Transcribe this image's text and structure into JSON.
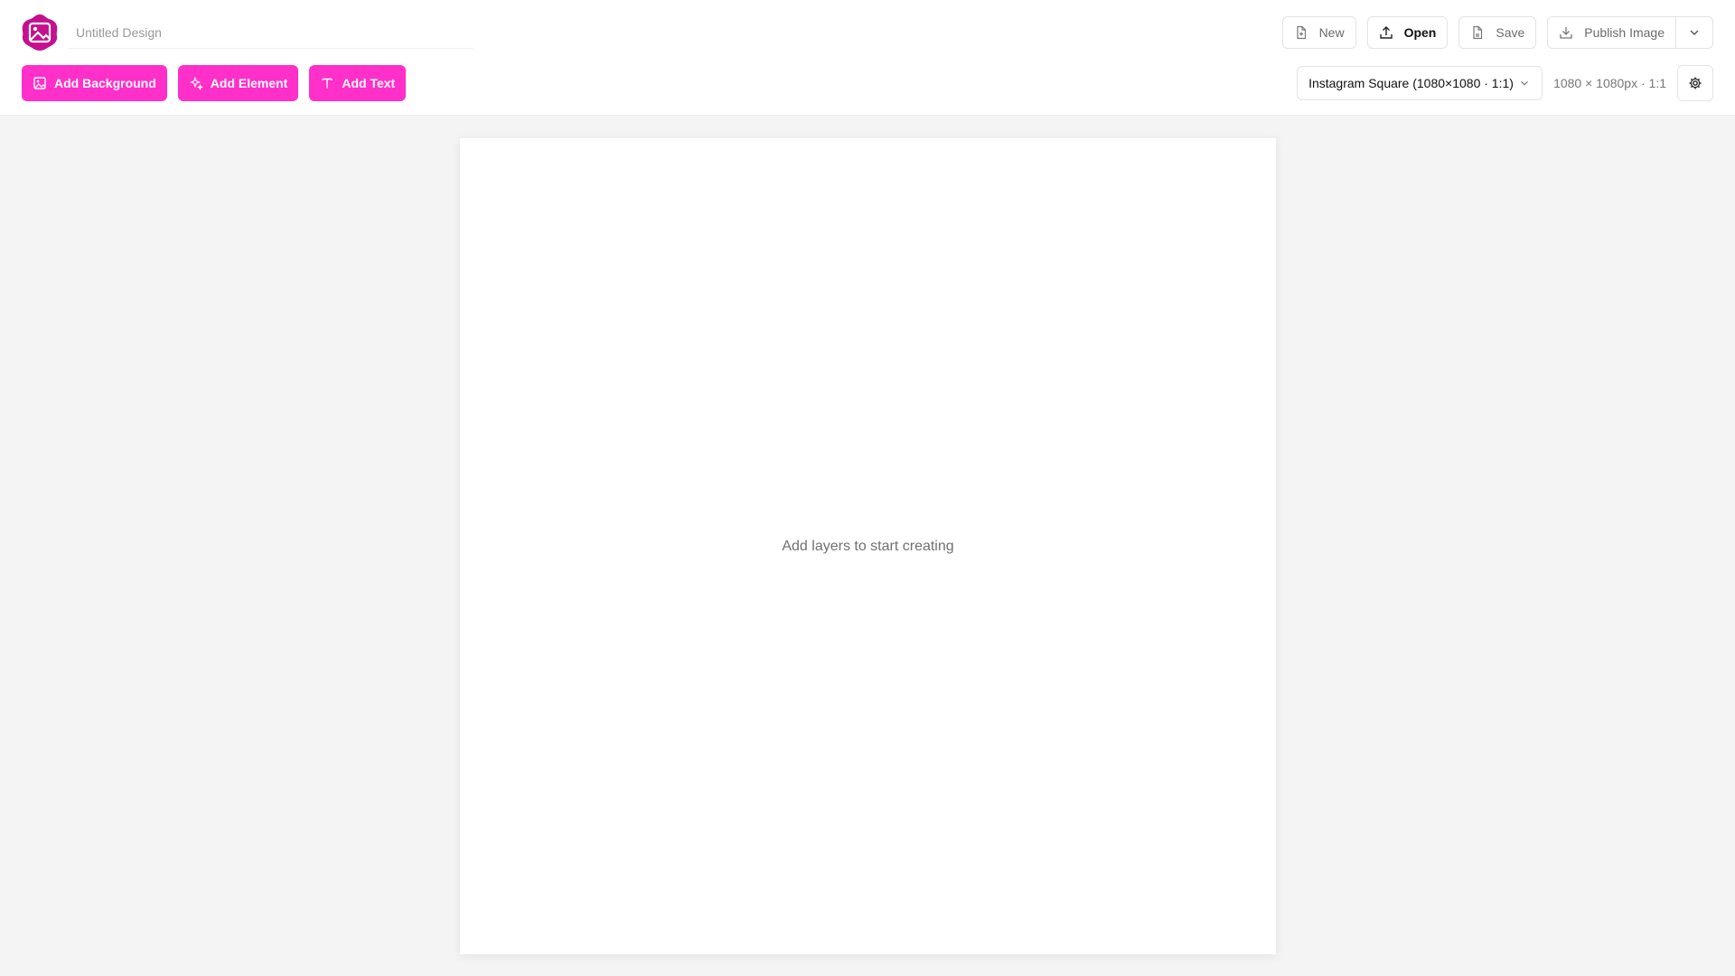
{
  "app": {
    "brand_color": "#ff2fc9",
    "logo_color": "#c4108f",
    "logo_icon": "image-gallery-icon"
  },
  "header": {
    "title_placeholder": "Untitled Design",
    "title_value": ""
  },
  "top_actions": {
    "new_label": "New",
    "open_label": "Open",
    "save_label": "Save",
    "publish_label": "Publish Image"
  },
  "add_actions": {
    "background_label": "Add Background",
    "element_label": "Add Element",
    "text_label": "Add Text"
  },
  "canvas_size": {
    "preset_selected": "Instagram Square (1080×1080 · 1:1)",
    "dimensions_label": "1080 × 1080px · 1:1"
  },
  "canvas": {
    "empty_message": "Add layers to start creating"
  }
}
